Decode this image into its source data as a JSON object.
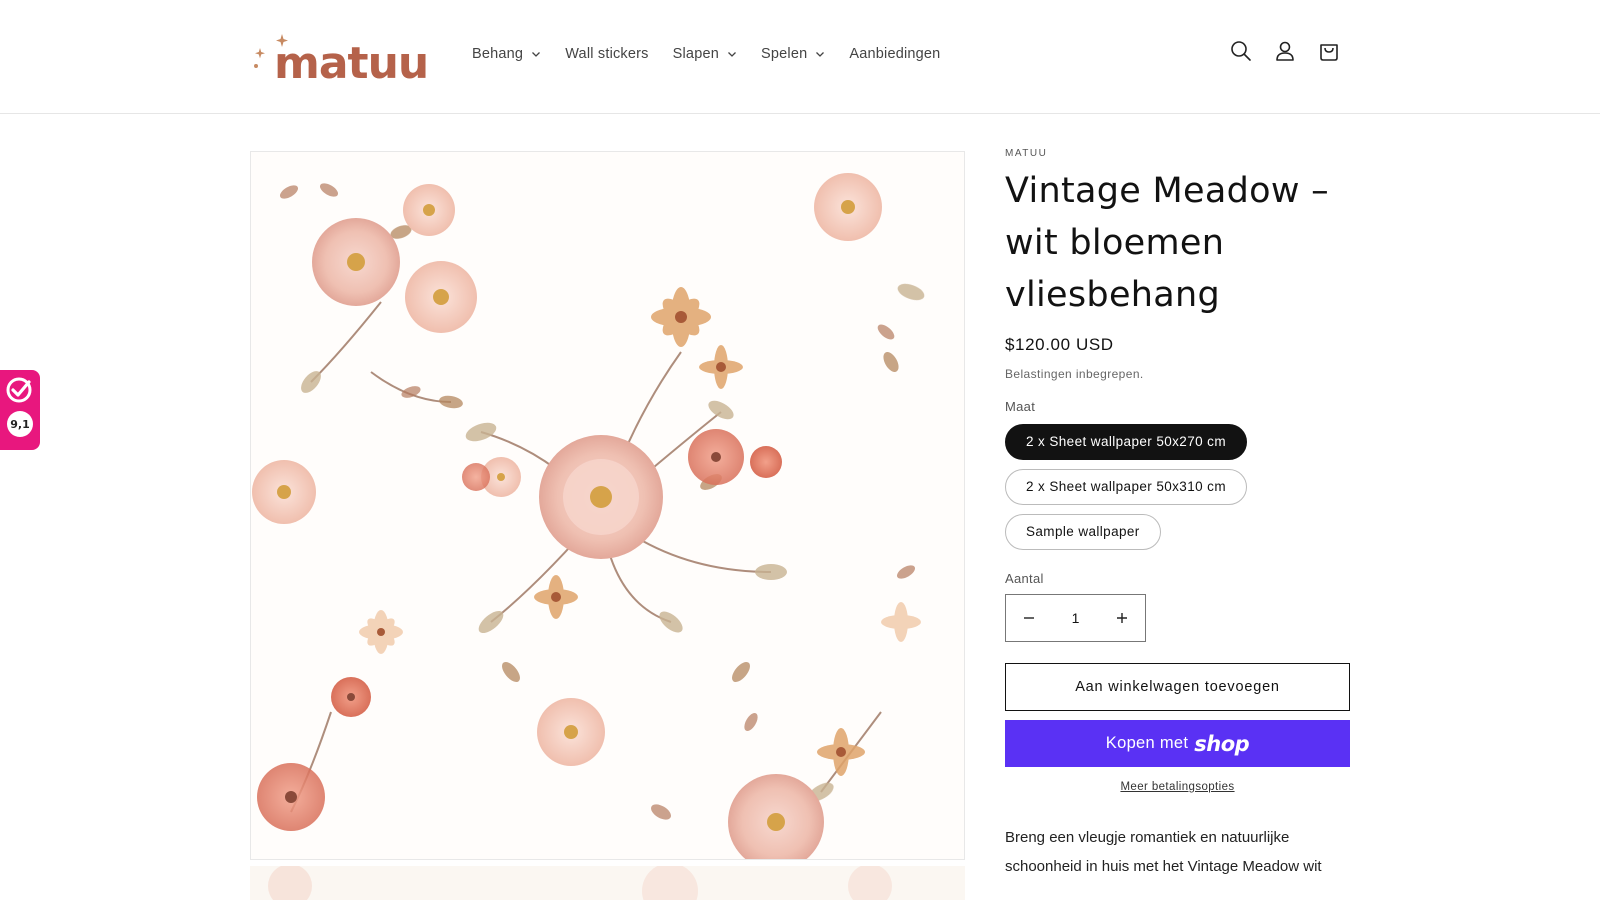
{
  "brand": {
    "name": "matuu",
    "color": "#b5624a"
  },
  "nav": {
    "items": [
      {
        "label": "Behang",
        "has_dropdown": true
      },
      {
        "label": "Wall stickers",
        "has_dropdown": false
      },
      {
        "label": "Slapen",
        "has_dropdown": true
      },
      {
        "label": "Spelen",
        "has_dropdown": true
      },
      {
        "label": "Aanbiedingen",
        "has_dropdown": false
      }
    ]
  },
  "header_icons": [
    "search-icon",
    "account-icon",
    "cart-icon"
  ],
  "review_badge": {
    "score": "9,1",
    "color": "#e8177e"
  },
  "product": {
    "vendor": "MATUU",
    "title": "Vintage Meadow – wit bloemen vliesbehang",
    "price": "$120.00 USD",
    "tax_note": "Belastingen inbegrepen.",
    "size_label": "Maat",
    "sizes": [
      {
        "label": "2 x Sheet wallpaper 50x270 cm",
        "selected": true
      },
      {
        "label": "2 x Sheet wallpaper 50x310 cm",
        "selected": false
      },
      {
        "label": "Sample wallpaper",
        "selected": false
      }
    ],
    "quantity_label": "Aantal",
    "quantity": "1",
    "add_to_cart": "Aan winkelwagen toevoegen",
    "buy_prefix": "Kopen met",
    "buy_brand": "shop",
    "buy_color": "#5a31f4",
    "more_payment": "Meer betalingsopties",
    "description": "Breng een vleugje romantiek en natuurlijke schoonheid in huis met het Vintage Meadow wit"
  }
}
